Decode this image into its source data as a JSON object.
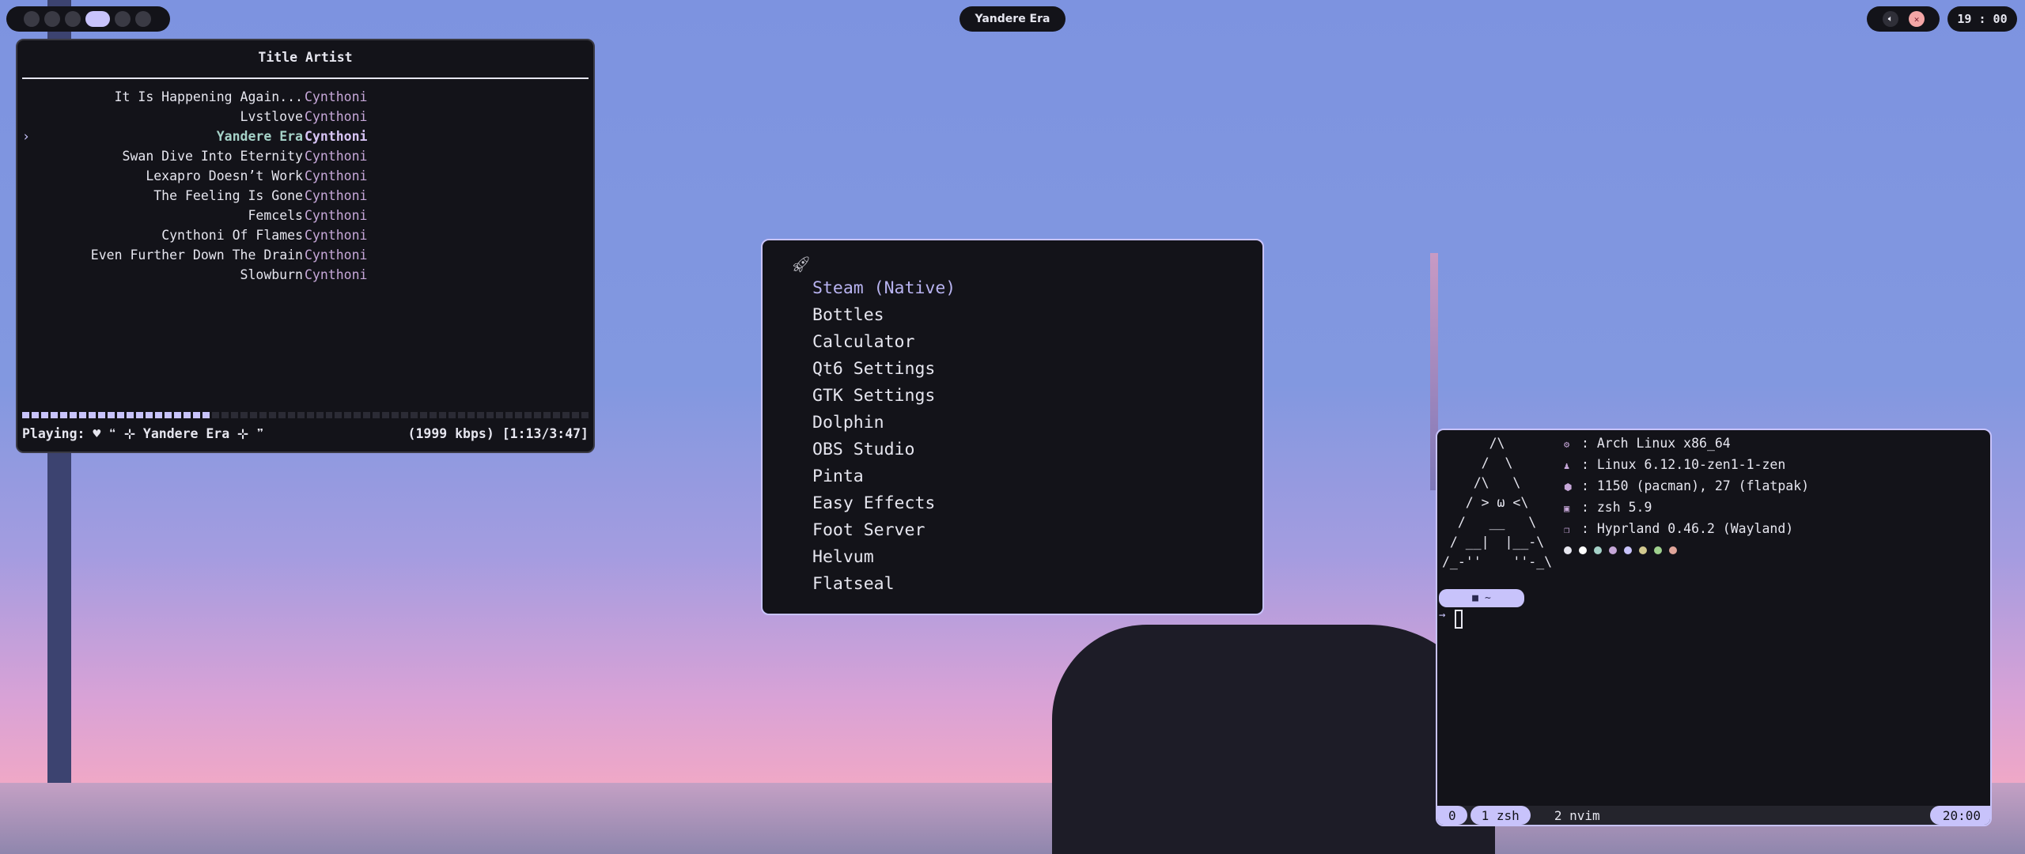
{
  "topbar": {
    "workspaces": [
      {
        "active": false
      },
      {
        "active": false
      },
      {
        "active": false
      },
      {
        "active": true
      },
      {
        "active": false
      },
      {
        "active": false
      }
    ],
    "window_title": "Yandere Era",
    "volume_icon": "speaker-icon",
    "mic_icon": "mic-muted-icon",
    "clock": "19 : 00"
  },
  "music": {
    "header": "Title Artist",
    "selector": "›",
    "tracks": [
      {
        "title": "It Is Happening Again...",
        "artist": "Cynthoni"
      },
      {
        "title": "Lvstlove",
        "artist": "Cynthoni"
      },
      {
        "title": "Yandere Era",
        "artist": "Cynthoni",
        "current": true
      },
      {
        "title": "Swan Dive Into Eternity",
        "artist": "Cynthoni"
      },
      {
        "title": "Lexapro Doesn’t Work",
        "artist": "Cynthoni"
      },
      {
        "title": "The Feeling Is Gone",
        "artist": "Cynthoni"
      },
      {
        "title": "Femcels",
        "artist": "Cynthoni"
      },
      {
        "title": "Cynthoni Of Flames",
        "artist": "Cynthoni"
      },
      {
        "title": "Even Further Down The Drain",
        "artist": "Cynthoni"
      },
      {
        "title": "Slowburn",
        "artist": "Cynthoni"
      }
    ],
    "progress": 0.33,
    "playing": "Playing: ♥ ❝ ⊹ Yandere Era ⊹ ❞",
    "bitrate_time": "(1999 kbps) [1:13/3:47]"
  },
  "launcher": {
    "icon": "rocket-icon",
    "items": [
      "Steam (Native)",
      "Bottles",
      "Calculator",
      "Qt6 Settings",
      "GTK Settings",
      "Dolphin",
      "OBS Studio",
      "Pinta",
      "Easy Effects",
      "Foot Server",
      "Helvum",
      "Flatseal"
    ]
  },
  "terminal": {
    "ascii_art": "      /\\\n     /  \\\n    /\\   \\\n   / > ω <\\\n  /   __   \\\n / __|  |__-\\\n/_-''    ''-_\\",
    "info": [
      {
        "icon": "gear-icon",
        "glyph": "⚙",
        "text": ": Arch Linux x86_64"
      },
      {
        "icon": "penguin-icon",
        "glyph": "♟",
        "text": ": Linux 6.12.10-zen1-1-zen"
      },
      {
        "icon": "package-icon",
        "glyph": "⬢",
        "text": ": 1150 (pacman), 27 (flatpak)"
      },
      {
        "icon": "shell-icon",
        "glyph": "▣",
        "text": ": zsh 5.9"
      },
      {
        "icon": "window-icon",
        "glyph": "❐",
        "text": ": Hyprland 0.46.2 (Wayland)"
      }
    ],
    "palette": [
      "#e6e6ef",
      "#ffffff",
      "#a5d2c8",
      "#c6a7d8",
      "#c8c3fb",
      "#d2c98f",
      "#9fd18e",
      "#e0a59a"
    ],
    "prompt_dir": "~",
    "prompt_arrow": "→",
    "tmux": {
      "session": "0",
      "win1": "1 zsh",
      "win2": "2 nvim",
      "time": "20:00"
    }
  }
}
